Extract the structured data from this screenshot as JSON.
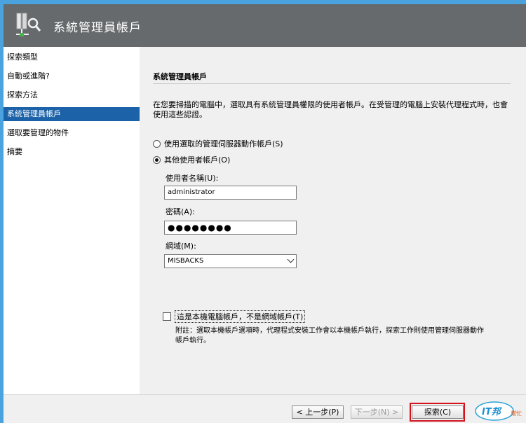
{
  "window": {
    "title": "系統管理員帳戶"
  },
  "sidebar": {
    "items": [
      {
        "label": "探索類型"
      },
      {
        "label": "自動或進階?"
      },
      {
        "label": "探索方法"
      },
      {
        "label": "系統管理員帳戶"
      },
      {
        "label": "選取要管理的物件"
      },
      {
        "label": "摘要"
      }
    ],
    "active_index": 3
  },
  "main": {
    "section_title": "系統管理員帳戶",
    "description": "在您要掃描的電腦中，選取具有系統管理員權限的使用者帳戶。在受管理的電腦上安裝代理程式時，也會使用這些認證。",
    "radio_action_account": "使用選取的管理伺服器動作帳戶(S)",
    "radio_other_account": "其他使用者帳戶(O)",
    "selected_radio": "other",
    "username_label": "使用者名稱(U):",
    "username_value": "administrator",
    "password_label": "密碼(A):",
    "password_value": "●●●●●●●●",
    "domain_label": "網域(M):",
    "domain_value": "MISBACKS",
    "local_account_checkbox": "這是本機電腦帳戶，不是網域帳戶(T)",
    "local_account_checked": false,
    "note": "附註：選取本機帳戶選項時，代理程式安裝工作會以本機帳戶執行，探索工作則使用管理伺服器動作帳戶執行。"
  },
  "footer": {
    "prev_label": "< 上一步(P)",
    "next_label": "下一步(N) >",
    "discover_label": "探索(C)",
    "logo_text": "IT邦",
    "logo_subtext": "幫忙"
  },
  "colors": {
    "header_bg": "#666a6d",
    "active_nav": "#1c62a8",
    "focus_border": "#d4131d",
    "desktop_bg": "#4aa3df"
  }
}
